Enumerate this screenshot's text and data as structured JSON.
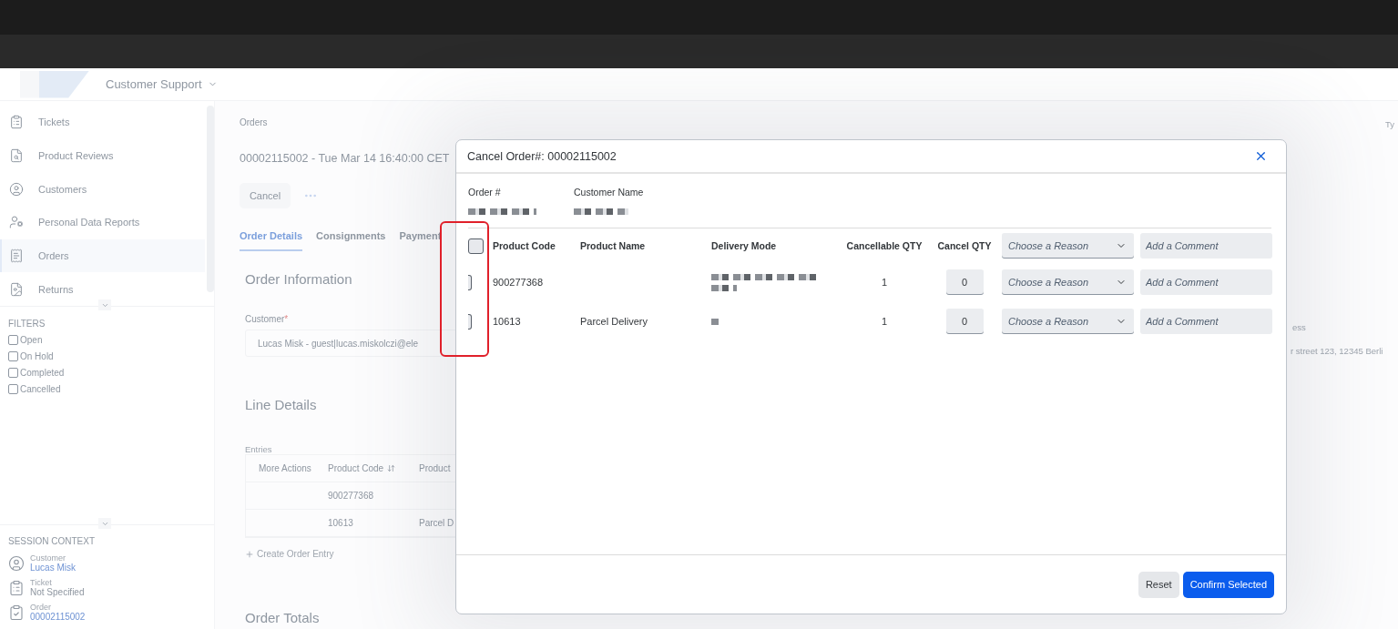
{
  "header": {
    "app_title": "Customer Support"
  },
  "sidebar": {
    "nav": [
      {
        "label": "Tickets",
        "kind": "tickets",
        "selected": false
      },
      {
        "label": "Product Reviews",
        "kind": "reviews",
        "selected": false
      },
      {
        "label": "Customers",
        "kind": "customers",
        "selected": false
      },
      {
        "label": "Personal Data Reports",
        "kind": "reports",
        "selected": false
      },
      {
        "label": "Orders",
        "kind": "orders",
        "selected": true
      },
      {
        "label": "Returns",
        "kind": "returns",
        "selected": false
      }
    ],
    "filters": {
      "title": "FILTERS",
      "items": [
        {
          "label": "Open",
          "checked": false
        },
        {
          "label": "On Hold",
          "checked": false
        },
        {
          "label": "Completed",
          "checked": false
        },
        {
          "label": "Cancelled",
          "checked": false
        }
      ]
    },
    "session": {
      "title": "SESSION CONTEXT",
      "items": [
        {
          "label": "Customer",
          "value": "Lucas Misk",
          "kind": "customer",
          "link": true
        },
        {
          "label": "Ticket",
          "value": "Not Specified",
          "kind": "ticket",
          "link": false
        },
        {
          "label": "Order",
          "value": "00002115002",
          "kind": "order",
          "link": true
        }
      ]
    }
  },
  "page": {
    "breadcrumb": "Orders",
    "title": "00002115002 - Tue Mar 14 16:40:00 CET",
    "cancel_button": "Cancel",
    "tabs": [
      {
        "label": "Order Details",
        "selected": true
      },
      {
        "label": "Consignments",
        "selected": false
      },
      {
        "label": "Payment",
        "selected": false
      }
    ],
    "order_information": {
      "title": "Order Information",
      "customer_label": "Customer",
      "required_mark": "*",
      "customer_value": "Lucas Misk - guest|lucas.miskolczi@ele"
    },
    "line_details": {
      "title": "Line Details",
      "entries_label": "Entries",
      "columns": [
        "More Actions",
        "Product Code",
        "Product"
      ],
      "rows": [
        {
          "product_code": "900277368"
        },
        {
          "product_code": "10613",
          "product": "Parcel D"
        }
      ],
      "create_entry": "Create Order Entry"
    },
    "order_totals_title": "Order Totals",
    "right_column": {
      "top_label": "Ty",
      "address_label": "ess",
      "address_value": "r street 123, 12345 Berli"
    }
  },
  "dialog": {
    "title": "Cancel Order#: 00002115002",
    "fields": [
      {
        "label": "Order #"
      },
      {
        "label": "Customer Name"
      }
    ],
    "all_checked": false,
    "columns": [
      "Product Code",
      "Product Name",
      "Delivery Mode",
      "Cancellable QTY",
      "Cancel QTY"
    ],
    "header_reason_placeholder": "Choose a Reason",
    "header_comment_placeholder": "Add a Comment",
    "rows": [
      {
        "checked": false,
        "product_code": "900277368",
        "cancellable": "1",
        "cancel_qty": "0",
        "reason_placeholder": "Choose a Reason",
        "comment_placeholder": "Add a Comment"
      },
      {
        "checked": false,
        "product_code": "10613",
        "product_name": "Parcel Delivery",
        "cancellable": "1",
        "cancel_qty": "0",
        "reason_placeholder": "Choose a Reason",
        "comment_placeholder": "Add a Comment"
      }
    ],
    "buttons": [
      {
        "label": "Reset",
        "kind": "secondary"
      },
      {
        "label": "Confirm Selected",
        "kind": "primary"
      }
    ]
  }
}
